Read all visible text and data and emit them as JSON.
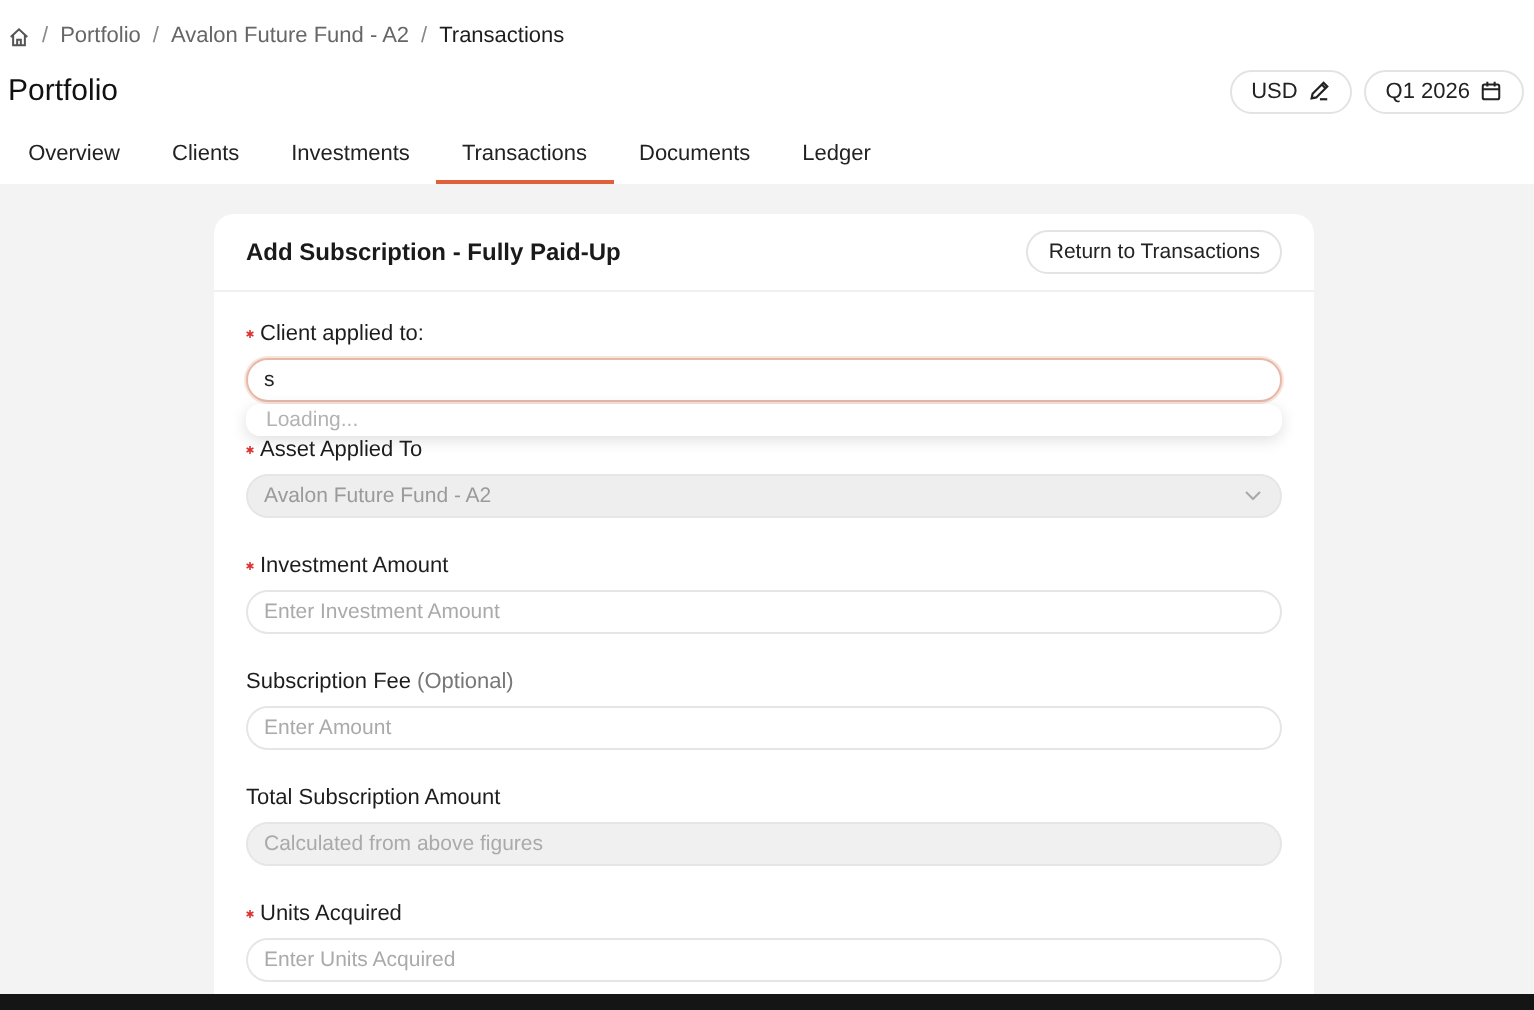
{
  "breadcrumb": [
    {
      "separator": "/",
      "label": "Portfolio"
    },
    {
      "separator": "/",
      "label": "Avalon Future Fund - A2"
    },
    {
      "separator": "/",
      "label": "Transactions"
    }
  ],
  "page_title": "Portfolio",
  "header_buttons": [
    {
      "label": "USD"
    },
    {
      "label": "Q1 2026"
    }
  ],
  "tabs": [
    {
      "label": "Overview",
      "selected": false
    },
    {
      "label": "Clients",
      "selected": false
    },
    {
      "label": "Investments",
      "selected": false
    },
    {
      "label": "Transactions",
      "selected": true
    },
    {
      "label": "Documents",
      "selected": false
    },
    {
      "label": "Ledger",
      "selected": false
    }
  ],
  "form": {
    "title": "Add Subscription - Fully Paid-Up",
    "return_button": "Return to Transactions",
    "fields": [
      {
        "label": "Client applied to:",
        "required": true,
        "kind": "text",
        "value": "s",
        "focused": true,
        "disabled": false,
        "dropdown_status": "Loading..."
      },
      {
        "label": "Asset Applied To",
        "required": true,
        "kind": "select",
        "value": "Avalon Future Fund - A2",
        "focused": false,
        "disabled": true
      },
      {
        "label": "Investment Amount",
        "required": true,
        "kind": "text",
        "placeholder": "Enter Investment Amount",
        "focused": false,
        "disabled": false
      },
      {
        "label": "Subscription Fee",
        "optional_hint": "(Optional)",
        "required": false,
        "kind": "text",
        "placeholder": "Enter Amount",
        "focused": false,
        "disabled": false
      },
      {
        "label": "Total Subscription Amount",
        "required": false,
        "kind": "text",
        "placeholder": "Calculated from above figures",
        "focused": false,
        "disabled": true
      },
      {
        "label": "Units Acquired",
        "required": true,
        "kind": "text",
        "placeholder": "Enter Units Acquired",
        "focused": false,
        "disabled": false
      }
    ]
  }
}
